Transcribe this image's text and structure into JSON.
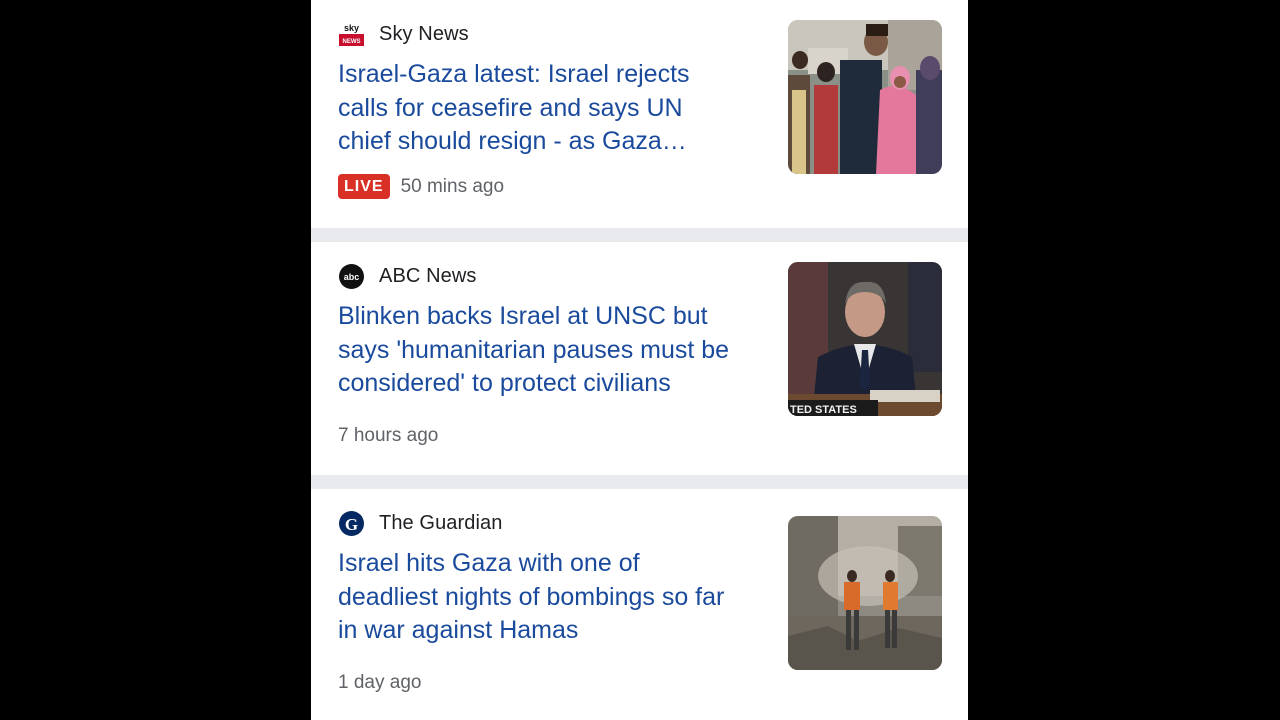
{
  "articles": [
    {
      "source": "Sky News",
      "logo_icon": "sky-news-logo",
      "headline_lines": [
        "Israel-Gaza latest: Israel rejects",
        "calls for ceasefire and says UN",
        "chief should resign - as Gaza…"
      ],
      "badge": "LIVE",
      "time": "50 mins ago",
      "thumbnail": "crowd-photo"
    },
    {
      "source": "ABC News",
      "logo_icon": "abc-news-logo",
      "headline_lines": [
        "Blinken backs Israel at UNSC but",
        "says 'humanitarian pauses must be",
        "considered' to protect civilians"
      ],
      "time": "7 hours ago",
      "thumbnail": "speaker-photo",
      "thumbnail_caption": "TED STATES"
    },
    {
      "source": "The Guardian",
      "logo_icon": "guardian-logo",
      "headline_lines": [
        "Israel hits Gaza with one of",
        "deadliest nights of bombings so far",
        "in war against Hamas"
      ],
      "time": "1 day ago",
      "thumbnail": "rubble-photo"
    }
  ],
  "colors": {
    "headline": "#1a4a9c",
    "live_badge": "#d93025",
    "meta": "#5f6368",
    "divider": "#e8eaed"
  }
}
